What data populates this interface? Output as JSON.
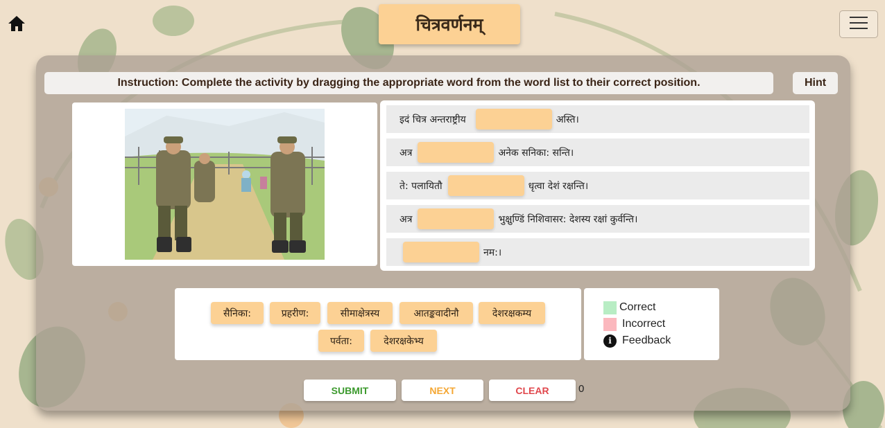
{
  "header": {
    "title": "चित्रवर्णनम्",
    "home_icon": "home-icon",
    "menu_icon": "hamburger-menu-icon"
  },
  "instruction": {
    "text": "Instruction: Complete the activity by dragging the appropriate word from the word list to their correct position.",
    "hint_label": "Hint"
  },
  "image": {
    "description_icon": "soldiers-at-border-illustration"
  },
  "sentences": [
    {
      "before": "इदं चित्र अन्तराष्ट्रीय",
      "after": "अस्ति।"
    },
    {
      "before": "अत्र",
      "after": "अनेक सनिका: सन्ति।"
    },
    {
      "before": "ते: पलायितौ",
      "after": "धृत्वा देशं रक्षन्ति।"
    },
    {
      "before": "अत्र",
      "after": "भुक्षुण्डिं निशिवासर: देशस्य रक्षां कुर्वन्ति।"
    },
    {
      "before": "",
      "after": "नम:।"
    }
  ],
  "word_list": [
    "सैनिका:",
    "प्रहरीण:",
    "सीमाक्षेत्रस्य",
    "आतङ्कवादीनौ",
    "देशरक्षकम्य",
    "पर्वता:",
    "देशरक्षकेभ्य"
  ],
  "legend": {
    "correct_label": "Correct",
    "incorrect_label": "Incorrect",
    "feedback_label": "Feedback",
    "correct_color": "#b8edc4",
    "incorrect_color": "#fbb8be",
    "info_icon": "info-icon"
  },
  "actions": {
    "submit_label": "SUBMIT",
    "next_label": "NEXT",
    "clear_label": "CLEAR",
    "submit_color": "#3c9a2e",
    "next_color": "#f5a733",
    "clear_color": "#e0474c"
  },
  "score": "0"
}
